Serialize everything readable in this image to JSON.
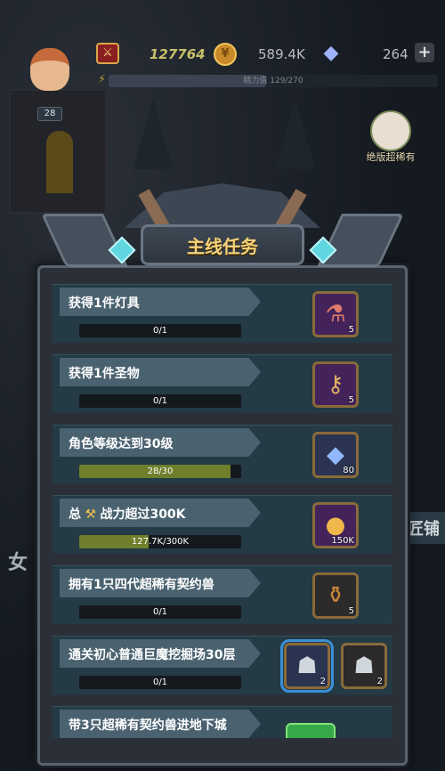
{
  "hud": {
    "avatar_level": "28",
    "power_value": "127764",
    "coins": "589.4K",
    "gems": "264",
    "plus_label": "+",
    "energy_text": "精力值 129/270",
    "energy_ratio": 0.478
  },
  "event": {
    "label": "绝版超稀有"
  },
  "scene": {
    "side_label": "匠铺",
    "left_char": "女"
  },
  "panel": {
    "title": "主线任务"
  },
  "tasks": [
    {
      "title": "获得1件灯具",
      "progress_text": "0/1",
      "progress_ratio": 0,
      "rewards": [
        {
          "icon": "potion-icon",
          "glyph": "⚗",
          "count": "5",
          "style": "purple"
        }
      ]
    },
    {
      "title": "获得1件圣物",
      "progress_text": "0/1",
      "progress_ratio": 0,
      "rewards": [
        {
          "icon": "key-icon",
          "glyph": "⚷",
          "count": "5",
          "style": "purple"
        }
      ]
    },
    {
      "title": "角色等级达到30级",
      "progress_text": "28/30",
      "progress_ratio": 0.933,
      "rewards": [
        {
          "icon": "crystal-icon",
          "glyph": "◆",
          "count": "80",
          "style": "blue"
        }
      ]
    },
    {
      "title_prefix": "总",
      "title_icon": "wrench-icon",
      "title_suffix": "战力超过300K",
      "progress_text": "127.7K/300K",
      "progress_ratio": 0.426,
      "rewards": [
        {
          "icon": "gold-coin-icon",
          "glyph": "●",
          "count": "150K",
          "style": "purple"
        }
      ]
    },
    {
      "title": "拥有1只四代超稀有契约兽",
      "progress_text": "0/1",
      "progress_ratio": 0,
      "rewards": [
        {
          "icon": "urn-icon",
          "glyph": "⚱",
          "count": "5",
          "style": "dark"
        }
      ]
    },
    {
      "title": "通关初心普通巨魔挖掘场30层",
      "progress_text": "0/1",
      "progress_ratio": 0,
      "rewards": [
        {
          "icon": "beast-card-icon",
          "glyph": "☗",
          "count": "2",
          "style": "blue",
          "selected": true
        },
        {
          "icon": "beast-card-icon",
          "glyph": "☗",
          "count": "2",
          "style": "dark"
        }
      ]
    },
    {
      "title": "带3只超稀有契约兽进地下城",
      "progress_text": "",
      "progress_ratio": 0,
      "rewards": []
    }
  ]
}
